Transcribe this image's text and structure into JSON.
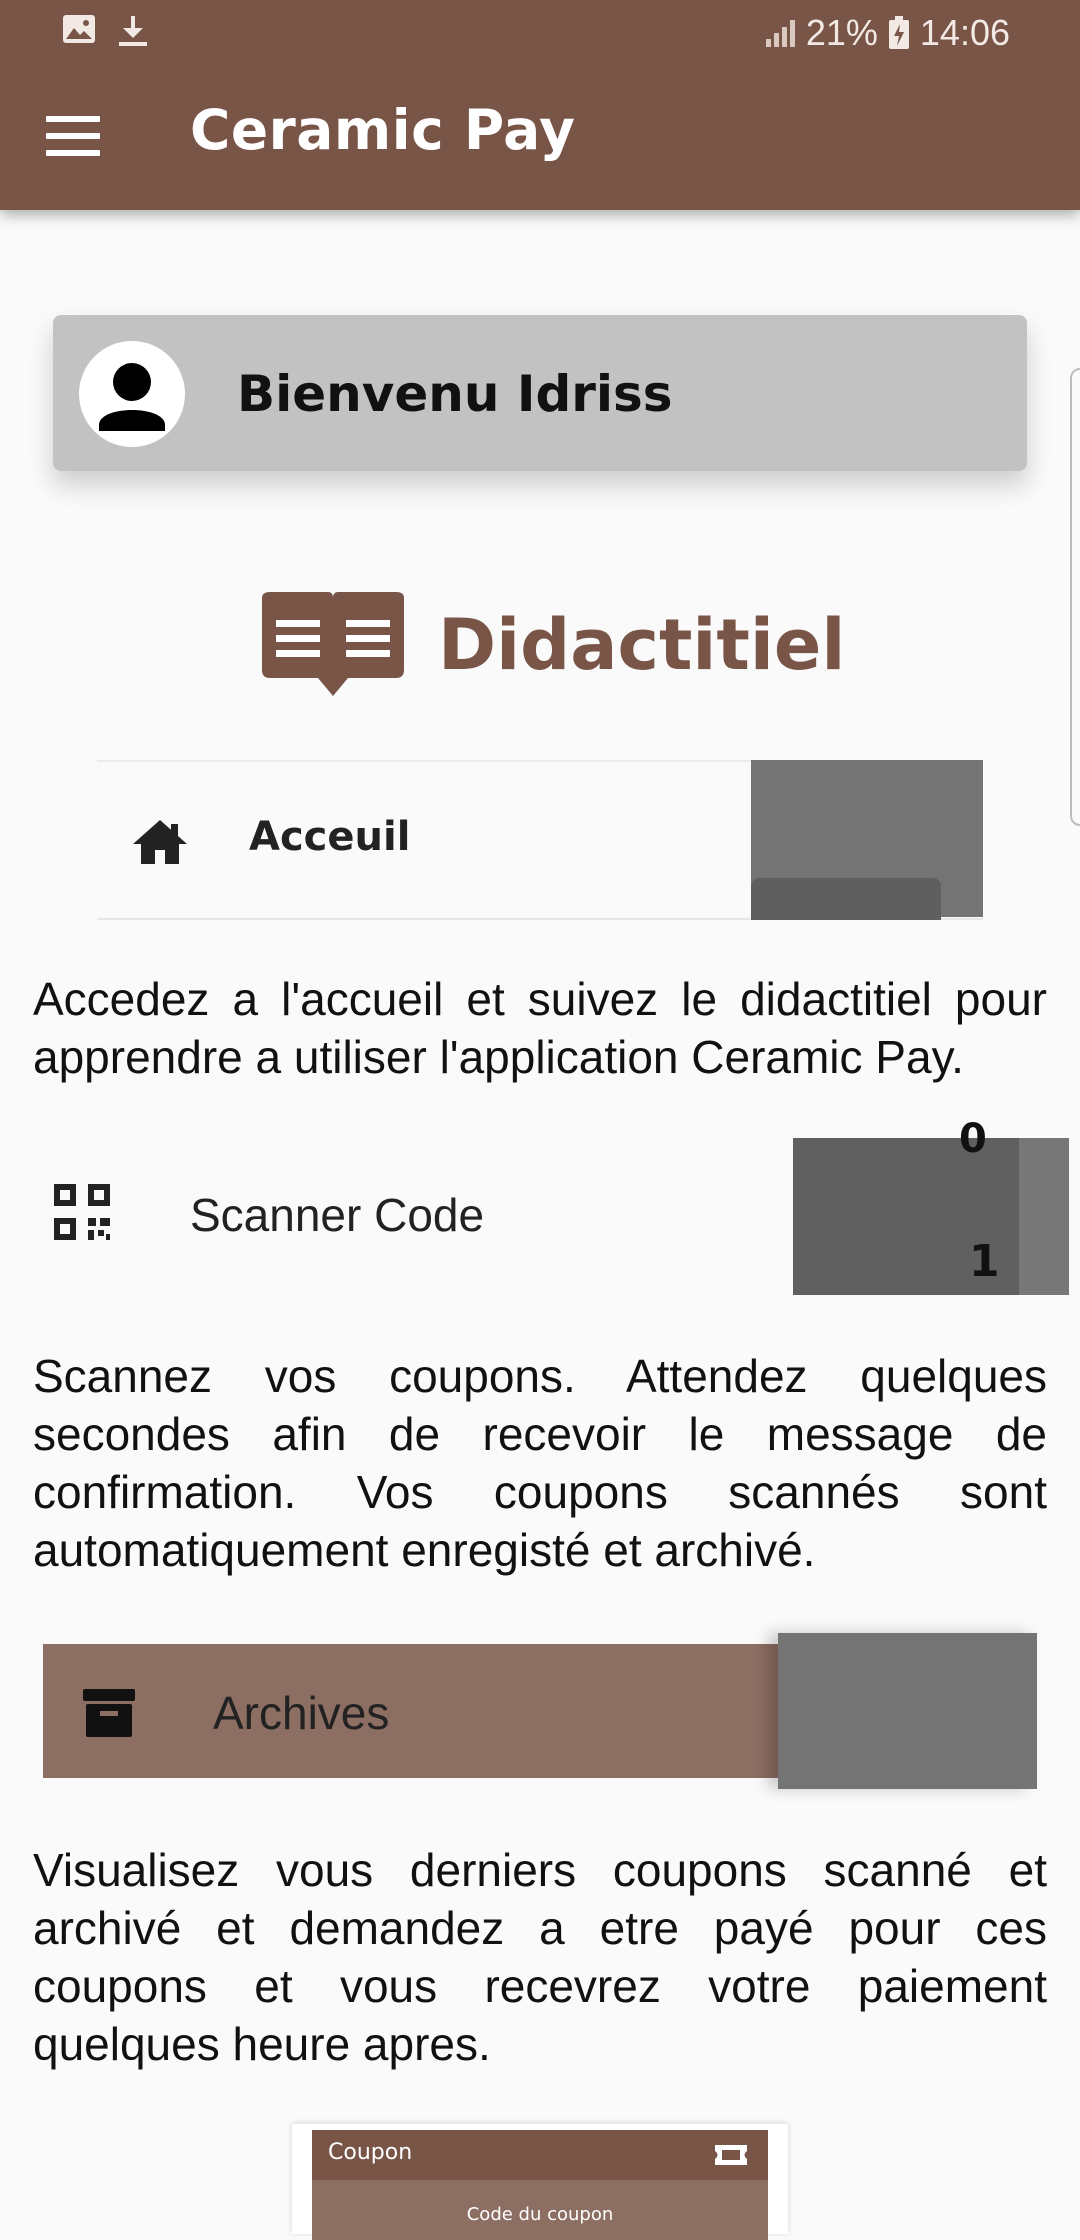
{
  "status_bar": {
    "left_icons": [
      "image-icon",
      "download-icon"
    ],
    "signal_icon": "signal-icon",
    "battery_percent": "21%",
    "battery_icon": "battery-charging-icon",
    "time": "14:06"
  },
  "app_bar": {
    "menu_icon": "hamburger-menu-icon",
    "title": "Ceramic Pay",
    "background_color": "#795548"
  },
  "welcome": {
    "avatar_icon": "person-icon",
    "text": "Bienvenu Idriss"
  },
  "tutorial": {
    "icon": "book-icon",
    "title": "Didactitiel",
    "accent_color": "#795548"
  },
  "sections": [
    {
      "icon": "home-icon",
      "label": "Acceuil",
      "description": "Accedez a l'accueil et suivez le didactitiel pour apprendre a utiliser l'application Ceramic Pay."
    },
    {
      "icon": "qr-code-icon",
      "label": "Scanner Code",
      "description": "Scannez vos coupons. Attendez quelques secondes afin de recevoir le message de confirmation. Vos coupons scannés sont automatiquement enregisté et archivé."
    },
    {
      "icon": "archive-box-icon",
      "label": "Archives",
      "description": "Visualisez vous derniers coupons scanné et archivé et demandez a etre payé pour ces coupons et vous recevrez votre paiement quelques heure apres."
    }
  ],
  "coupon_preview": {
    "title": "Coupon",
    "ticket_icon": "ticket-icon",
    "code_label": "Code du coupon"
  },
  "preview_digits": [
    "0",
    "1"
  ]
}
